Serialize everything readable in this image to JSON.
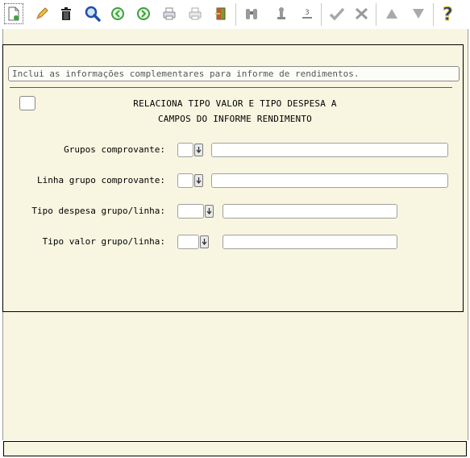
{
  "toolbar": {
    "buttons": [
      {
        "name": "new-icon"
      },
      {
        "name": "edit-icon"
      },
      {
        "name": "delete-icon"
      },
      {
        "name": "search-icon"
      },
      {
        "name": "previous-icon"
      },
      {
        "name": "next-icon"
      },
      {
        "name": "print-icon"
      },
      {
        "name": "print-preview-icon"
      },
      {
        "name": "exit-icon"
      },
      {
        "name": "binoculars-icon"
      },
      {
        "name": "chess-piece-icon"
      },
      {
        "name": "numbering-icon"
      },
      {
        "name": "confirm-icon"
      },
      {
        "name": "tools-icon"
      },
      {
        "name": "up-icon"
      },
      {
        "name": "down-icon"
      },
      {
        "name": "help-icon"
      }
    ]
  },
  "form": {
    "description": "Inclui as informações complementares para informe de rendimentos.",
    "title_line1": "RELACIONA TIPO VALOR E TIPO DESPESA A",
    "title_line2": "CAMPOS DO INFORME RENDIMENTO",
    "fields": [
      {
        "label": "Grupos comprovante:",
        "code": "",
        "text": ""
      },
      {
        "label": "Linha grupo comprovante:",
        "code": "",
        "text": ""
      },
      {
        "label": "Tipo despesa grupo/linha:",
        "code": "",
        "text": ""
      },
      {
        "label": "Tipo valor grupo/linha:",
        "code": "",
        "text": ""
      }
    ]
  },
  "colors": {
    "background": "#f8f6e1",
    "divider": "#b03a2e"
  }
}
